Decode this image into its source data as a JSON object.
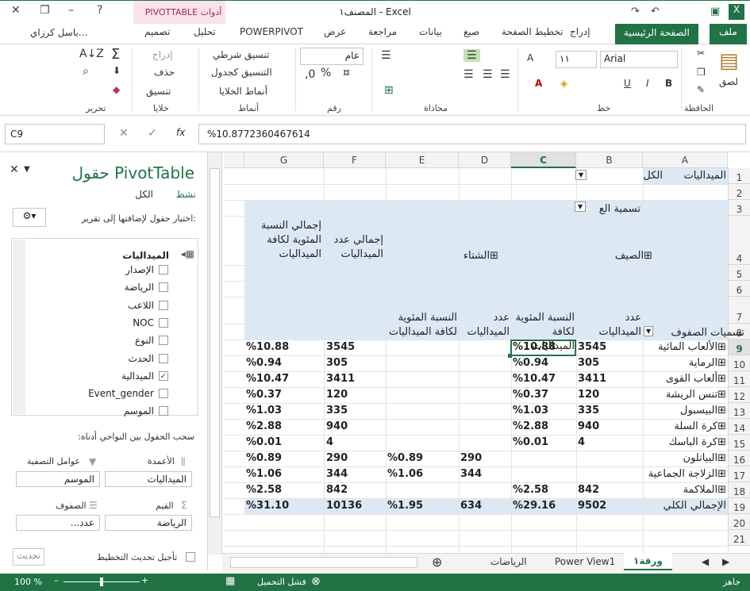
{
  "window": {
    "title": "المصنف١ - Excel",
    "contextual_tab": "أدوات PIVOTTABLE",
    "user": "باسل كرزاي..."
  },
  "tabs": [
    "ملف",
    "الصفحة الرئيسية",
    "إدراج",
    "تخطيط الصفحة",
    "صيغ",
    "بيانات",
    "مراجعة",
    "عرض",
    "POWERPIVOT",
    "تحليل",
    "تصميم"
  ],
  "ribbon": {
    "groups": {
      "clipboard": "الحافظة",
      "font": "خط",
      "alignment": "محاذاة",
      "number": "رقم",
      "styles": "أنماط",
      "cells": "خلايا",
      "editing": "تحرير"
    },
    "paste": "لصق",
    "font_name": "Arial",
    "font_size": "١١",
    "number_format": "عام",
    "cond_format": "تنسيق شرطي",
    "format_table": "التنسيق كجدول",
    "cell_styles": "أنماط الخلايا",
    "insert": "إدراج",
    "delete": "حذف",
    "format": "تنسيق"
  },
  "formula_bar": {
    "name_box": "C9",
    "value": "%10.8772360467614",
    "fx": "fx"
  },
  "pivot_pane": {
    "title": "حقول PivotTable",
    "tab_active": "نشط",
    "tab_all": "الكل",
    "choose_label": "اختيار حقول لإضافتها إلى تقرير:",
    "table_name": "الميداليات",
    "fields": [
      {
        "name": "الإصدار",
        "checked": false
      },
      {
        "name": "الرياضة",
        "checked": false
      },
      {
        "name": "اللاعب",
        "checked": false
      },
      {
        "name": "NOC",
        "checked": false
      },
      {
        "name": "النوع",
        "checked": false
      },
      {
        "name": "الحدث",
        "checked": false
      },
      {
        "name": "الميدالية",
        "checked": true
      },
      {
        "name": "Event_gender",
        "checked": false
      },
      {
        "name": "الموسم",
        "checked": false
      }
    ],
    "drag_label": "سحب الحقول بين النواحي أدناه:",
    "areas": {
      "columns": "الأعمدة",
      "filters": "عوامل التصفية",
      "values": "القيم",
      "rows": "الصفوف"
    },
    "columns_value": "الميداليات",
    "filters_value": "الموسم",
    "rows_value": "الرياضة",
    "values_value": "عدد...",
    "defer": "تأجيل تحديث التخطيط",
    "update": "تحديث"
  },
  "columns": [
    "A",
    "B",
    "C",
    "D",
    "E",
    "F",
    "G"
  ],
  "rows": [
    "1",
    "2",
    "3",
    "4",
    "5",
    "6",
    "7",
    "8",
    "9",
    "10",
    "11",
    "12",
    "13",
    "14",
    "15",
    "16",
    "17",
    "18",
    "19",
    "20",
    "21"
  ],
  "pivot": {
    "filter_label": "الميداليات",
    "filter_value": "الكل",
    "col_labels": "تسمية الع",
    "summer": "الصيف",
    "winter": "الشتاء",
    "count_h": "عدد الميداليات",
    "pct_h": "النسبة المئوية لكافة الميداليات",
    "total_count_h": "إجمالي عدد الميداليات",
    "total_pct_h": "إجمالي النسبة المئوية لكافة الميداليات",
    "row_labels": "تسميات الصفوف",
    "data": [
      {
        "name": "الألعاب المائية",
        "b": "3545",
        "c": "%10.88",
        "d": "",
        "e": "",
        "f": "3545",
        "g": "%10.88"
      },
      {
        "name": "الرماية",
        "b": "305",
        "c": "%0.94",
        "d": "",
        "e": "",
        "f": "305",
        "g": "%0.94"
      },
      {
        "name": "ألعاب القوى",
        "b": "3411",
        "c": "%10.47",
        "d": "",
        "e": "",
        "f": "3411",
        "g": "%10.47"
      },
      {
        "name": "تنس الريشة",
        "b": "120",
        "c": "%0.37",
        "d": "",
        "e": "",
        "f": "120",
        "g": "%0.37"
      },
      {
        "name": "البيسبول",
        "b": "335",
        "c": "%1.03",
        "d": "",
        "e": "",
        "f": "335",
        "g": "%1.03"
      },
      {
        "name": "كرة السلة",
        "b": "940",
        "c": "%2.88",
        "d": "",
        "e": "",
        "f": "940",
        "g": "%2.88"
      },
      {
        "name": "كرة الباسك",
        "b": "4",
        "c": "%0.01",
        "d": "",
        "e": "",
        "f": "4",
        "g": "%0.01"
      },
      {
        "name": "البياتلون",
        "b": "",
        "c": "",
        "d": "290",
        "e": "%0.89",
        "f": "290",
        "g": "%0.89"
      },
      {
        "name": "الزلاجة الجماعية",
        "b": "",
        "c": "",
        "d": "344",
        "e": "%1.06",
        "f": "344",
        "g": "%1.06"
      },
      {
        "name": "الملاكمة",
        "b": "842",
        "c": "%2.58",
        "d": "",
        "e": "",
        "f": "842",
        "g": "%2.58"
      },
      {
        "name": "الإجمالي الكلي",
        "b": "9502",
        "c": "%29.16",
        "d": "634",
        "e": "%1.95",
        "f": "10136",
        "g": "%31.10"
      }
    ]
  },
  "sheet_tabs": [
    "ورقة١",
    "Power View1",
    "الرياضات"
  ],
  "status": {
    "ready": "جاهز",
    "load_failed": "فشل التحميل",
    "zoom": "100 %"
  },
  "colors": {
    "accent": "#217346",
    "band": "#dce9f5",
    "contextual": "#a12a5c"
  }
}
